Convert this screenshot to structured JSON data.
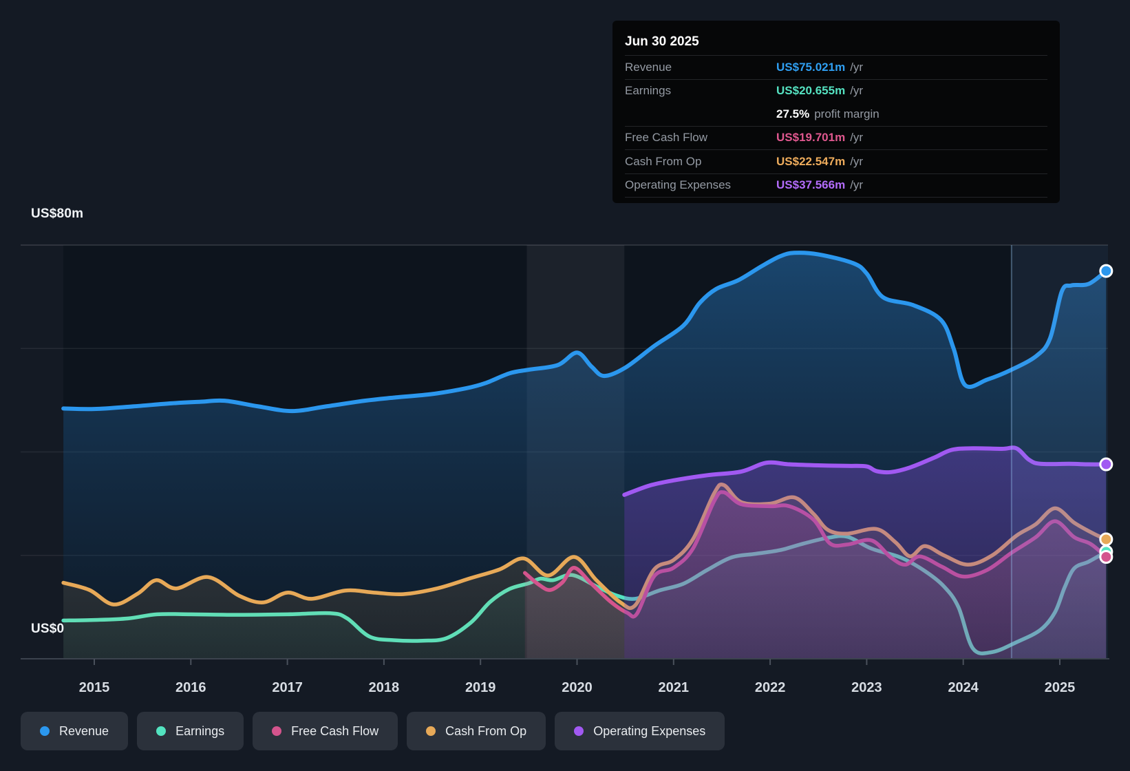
{
  "colors": {
    "background": "#141a24",
    "plot_background": "#0d141d",
    "revenue": "#2b97ee",
    "earnings": "#53e3c0",
    "free_cash_flow": "#d4548d",
    "cash_from_op": "#e7a958",
    "operating_expenses": "#a159f2",
    "axis_line": "#3c434e",
    "tick_label": "#d7dce3",
    "legend_pill_bg": "#2b313b",
    "tooltip_bg": "#060708"
  },
  "y_axis": {
    "top_label": "US$80m",
    "zero_label": "US$0"
  },
  "tooltip": {
    "date": "Jun 30 2025",
    "unit": "/yr",
    "revenue_label": "Revenue",
    "revenue_value": "US$75.021m",
    "earnings_label": "Earnings",
    "earnings_value": "US$20.655m",
    "margin_value": "27.5%",
    "margin_text": "profit margin",
    "fcf_label": "Free Cash Flow",
    "fcf_value": "US$19.701m",
    "cashop_label": "Cash From Op",
    "cashop_value": "US$22.547m",
    "opex_label": "Operating Expenses",
    "opex_value": "US$37.566m"
  },
  "legend": {
    "items": [
      {
        "label": "Revenue",
        "color_key": "revenue"
      },
      {
        "label": "Earnings",
        "color_key": "earnings"
      },
      {
        "label": "Free Cash Flow",
        "color_key": "free_cash_flow"
      },
      {
        "label": "Cash From Op",
        "color_key": "cash_from_op"
      },
      {
        "label": "Operating Expenses",
        "color_key": "operating_expenses"
      }
    ]
  },
  "chart_data": {
    "type": "area",
    "ylabel": "US$ millions per year",
    "ylim": [
      0,
      80
    ],
    "y_gridlines": [
      20,
      40,
      60,
      80
    ],
    "x_ticks": [
      "2015",
      "2016",
      "2017",
      "2018",
      "2019",
      "2020",
      "2021",
      "2022",
      "2023",
      "2024",
      "2025"
    ],
    "x_tick_years": [
      2015,
      2016,
      2017,
      2018,
      2019,
      2020,
      2021,
      2022,
      2023,
      2024,
      2025
    ],
    "highlight_band": {
      "from": 2019.48,
      "to": 2020.49
    },
    "divider_year": 2024.5,
    "series": [
      {
        "name": "Revenue",
        "color": "#2b97ee",
        "stroke_width": 6,
        "fill_top": "rgba(38,118,188,0.52)",
        "fill_bottom": "rgba(30,80,130,0.10)",
        "points": [
          [
            2014.68,
            48.4
          ],
          [
            2015.0,
            48.3
          ],
          [
            2015.4,
            48.8
          ],
          [
            2015.8,
            49.4
          ],
          [
            2016.1,
            49.7
          ],
          [
            2016.35,
            49.9
          ],
          [
            2016.7,
            48.8
          ],
          [
            2017.05,
            47.9
          ],
          [
            2017.4,
            48.8
          ],
          [
            2017.8,
            49.9
          ],
          [
            2018.1,
            50.5
          ],
          [
            2018.5,
            51.2
          ],
          [
            2018.85,
            52.3
          ],
          [
            2019.05,
            53.3
          ],
          [
            2019.3,
            55.2
          ],
          [
            2019.5,
            55.9
          ],
          [
            2019.8,
            56.8
          ],
          [
            2020.0,
            59.2
          ],
          [
            2020.15,
            56.5
          ],
          [
            2020.28,
            54.7
          ],
          [
            2020.5,
            56.3
          ],
          [
            2020.8,
            60.5
          ],
          [
            2021.1,
            64.4
          ],
          [
            2021.27,
            68.8
          ],
          [
            2021.44,
            71.5
          ],
          [
            2021.67,
            73.2
          ],
          [
            2021.91,
            75.9
          ],
          [
            2022.1,
            77.8
          ],
          [
            2022.25,
            78.5
          ],
          [
            2022.5,
            78.2
          ],
          [
            2022.86,
            76.5
          ],
          [
            2023.0,
            74.5
          ],
          [
            2023.17,
            69.9
          ],
          [
            2023.48,
            68.4
          ],
          [
            2023.77,
            65.5
          ],
          [
            2023.9,
            60.0
          ],
          [
            2024.02,
            52.9
          ],
          [
            2024.25,
            54.0
          ],
          [
            2024.5,
            55.9
          ],
          [
            2024.76,
            58.6
          ],
          [
            2024.9,
            62.0
          ],
          [
            2025.02,
            71.0
          ],
          [
            2025.12,
            72.2
          ],
          [
            2025.3,
            72.5
          ],
          [
            2025.48,
            75.0
          ]
        ]
      },
      {
        "name": "Earnings",
        "color": "#53e3c0",
        "stroke_width": 5.5,
        "fill_top": "rgba(86,226,192,0.25)",
        "fill_bottom": "rgba(86,226,192,0.05)",
        "points": [
          [
            2014.68,
            7.4
          ],
          [
            2015.0,
            7.5
          ],
          [
            2015.35,
            7.8
          ],
          [
            2015.65,
            8.6
          ],
          [
            2016.0,
            8.6
          ],
          [
            2016.5,
            8.5
          ],
          [
            2017.0,
            8.6
          ],
          [
            2017.45,
            8.8
          ],
          [
            2017.62,
            7.8
          ],
          [
            2017.85,
            4.3
          ],
          [
            2018.1,
            3.6
          ],
          [
            2018.4,
            3.5
          ],
          [
            2018.65,
            4.0
          ],
          [
            2018.9,
            7.0
          ],
          [
            2019.1,
            11.0
          ],
          [
            2019.3,
            13.5
          ],
          [
            2019.5,
            14.6
          ],
          [
            2019.62,
            15.5
          ],
          [
            2019.75,
            15.2
          ],
          [
            2019.95,
            16.2
          ],
          [
            2020.2,
            14.0
          ],
          [
            2020.4,
            12.3
          ],
          [
            2020.6,
            11.6
          ],
          [
            2020.85,
            13.2
          ],
          [
            2021.1,
            14.5
          ],
          [
            2021.35,
            17.2
          ],
          [
            2021.6,
            19.6
          ],
          [
            2021.85,
            20.3
          ],
          [
            2022.1,
            21.0
          ],
          [
            2022.35,
            22.3
          ],
          [
            2022.6,
            23.4
          ],
          [
            2022.8,
            23.6
          ],
          [
            2023.05,
            21.3
          ],
          [
            2023.35,
            19.6
          ],
          [
            2023.6,
            17.0
          ],
          [
            2023.8,
            14.0
          ],
          [
            2023.95,
            10.0
          ],
          [
            2024.1,
            2.0
          ],
          [
            2024.3,
            1.3
          ],
          [
            2024.55,
            3.2
          ],
          [
            2024.8,
            5.6
          ],
          [
            2024.95,
            9.0
          ],
          [
            2025.05,
            13.8
          ],
          [
            2025.15,
            17.5
          ],
          [
            2025.3,
            18.8
          ],
          [
            2025.48,
            20.7
          ]
        ]
      },
      {
        "name": "Cash From Op",
        "color": "#e7a958",
        "stroke_width": 5.5,
        "fill_top": "rgba(232,170,88,0.30)",
        "fill_bottom": "rgba(232,170,88,0.07)",
        "points": [
          [
            2014.68,
            14.7
          ],
          [
            2014.95,
            13.3
          ],
          [
            2015.2,
            10.5
          ],
          [
            2015.45,
            12.6
          ],
          [
            2015.64,
            15.2
          ],
          [
            2015.85,
            13.6
          ],
          [
            2016.18,
            15.8
          ],
          [
            2016.5,
            12.2
          ],
          [
            2016.75,
            10.9
          ],
          [
            2017.0,
            12.8
          ],
          [
            2017.25,
            11.6
          ],
          [
            2017.6,
            13.2
          ],
          [
            2017.9,
            12.8
          ],
          [
            2018.2,
            12.5
          ],
          [
            2018.55,
            13.6
          ],
          [
            2018.9,
            15.6
          ],
          [
            2019.2,
            17.3
          ],
          [
            2019.45,
            19.4
          ],
          [
            2019.7,
            16.1
          ],
          [
            2019.97,
            19.7
          ],
          [
            2020.2,
            15.2
          ],
          [
            2020.45,
            10.9
          ],
          [
            2020.6,
            10.3
          ],
          [
            2020.8,
            17.3
          ],
          [
            2021.0,
            19.1
          ],
          [
            2021.2,
            23.1
          ],
          [
            2021.42,
            32.0
          ],
          [
            2021.52,
            33.6
          ],
          [
            2021.7,
            30.3
          ],
          [
            2022.0,
            30.0
          ],
          [
            2022.25,
            31.2
          ],
          [
            2022.45,
            28.0
          ],
          [
            2022.6,
            24.9
          ],
          [
            2022.8,
            24.2
          ],
          [
            2023.1,
            25.1
          ],
          [
            2023.3,
            22.5
          ],
          [
            2023.45,
            19.8
          ],
          [
            2023.6,
            21.8
          ],
          [
            2023.8,
            20.0
          ],
          [
            2024.05,
            18.2
          ],
          [
            2024.3,
            20.0
          ],
          [
            2024.55,
            23.8
          ],
          [
            2024.75,
            26.0
          ],
          [
            2024.95,
            29.1
          ],
          [
            2025.15,
            26.3
          ],
          [
            2025.35,
            24.2
          ],
          [
            2025.48,
            23.1
          ]
        ]
      },
      {
        "name": "Free Cash Flow",
        "color": "#d4548d",
        "stroke_width": 5.5,
        "fill_top": "rgba(214,84,141,0.38)",
        "fill_bottom": "rgba(214,84,141,0.10)",
        "points": [
          [
            2019.46,
            16.6
          ],
          [
            2019.6,
            14.4
          ],
          [
            2019.72,
            13.3
          ],
          [
            2019.85,
            14.8
          ],
          [
            2019.97,
            17.6
          ],
          [
            2020.15,
            14.5
          ],
          [
            2020.35,
            11.0
          ],
          [
            2020.52,
            8.9
          ],
          [
            2020.62,
            8.7
          ],
          [
            2020.8,
            16.0
          ],
          [
            2021.0,
            17.6
          ],
          [
            2021.2,
            21.3
          ],
          [
            2021.42,
            30.5
          ],
          [
            2021.52,
            32.2
          ],
          [
            2021.7,
            29.9
          ],
          [
            2022.0,
            29.5
          ],
          [
            2022.2,
            29.5
          ],
          [
            2022.45,
            26.9
          ],
          [
            2022.62,
            22.3
          ],
          [
            2022.8,
            22.1
          ],
          [
            2023.05,
            22.9
          ],
          [
            2023.25,
            19.6
          ],
          [
            2023.4,
            18.2
          ],
          [
            2023.55,
            19.8
          ],
          [
            2023.78,
            17.8
          ],
          [
            2024.0,
            15.9
          ],
          [
            2024.25,
            17.2
          ],
          [
            2024.5,
            20.5
          ],
          [
            2024.75,
            23.5
          ],
          [
            2024.95,
            26.6
          ],
          [
            2025.15,
            23.5
          ],
          [
            2025.32,
            22.2
          ],
          [
            2025.48,
            19.7
          ]
        ]
      },
      {
        "name": "Operating Expenses",
        "color": "#a159f2",
        "stroke_width": 6,
        "fill_top": "rgba(142,80,230,0.50)",
        "fill_bottom": "rgba(120,70,200,0.25)",
        "points": [
          [
            2020.49,
            31.7
          ],
          [
            2020.75,
            33.5
          ],
          [
            2021.0,
            34.5
          ],
          [
            2021.35,
            35.5
          ],
          [
            2021.7,
            36.2
          ],
          [
            2021.96,
            37.9
          ],
          [
            2022.2,
            37.6
          ],
          [
            2022.5,
            37.4
          ],
          [
            2022.8,
            37.3
          ],
          [
            2023.0,
            37.2
          ],
          [
            2023.1,
            36.3
          ],
          [
            2023.25,
            36.1
          ],
          [
            2023.45,
            37.0
          ],
          [
            2023.7,
            38.9
          ],
          [
            2023.88,
            40.4
          ],
          [
            2024.1,
            40.7
          ],
          [
            2024.4,
            40.6
          ],
          [
            2024.55,
            40.7
          ],
          [
            2024.68,
            38.5
          ],
          [
            2024.8,
            37.7
          ],
          [
            2025.1,
            37.7
          ],
          [
            2025.3,
            37.6
          ],
          [
            2025.48,
            37.6
          ]
        ]
      }
    ]
  }
}
